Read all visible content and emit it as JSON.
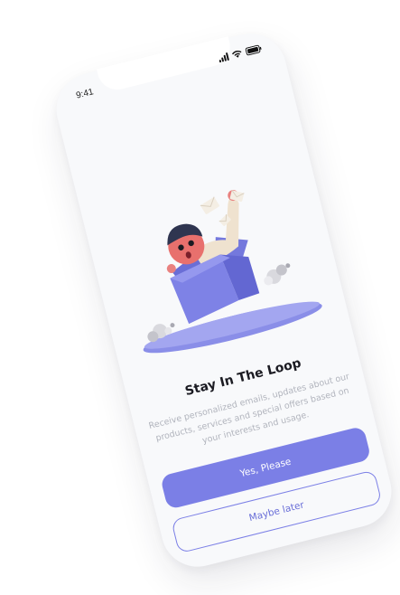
{
  "status_bar": {
    "time": "9:41"
  },
  "onboarding": {
    "illustration": "boy-in-box-with-letters",
    "title": "Stay In The Loop",
    "description": "Receive personalized emails, updates about our products, services and special offers based on your interests and usage."
  },
  "actions": {
    "primary_label": "Yes, Please",
    "secondary_label": "Maybe later"
  },
  "colors": {
    "accent": "#7b7fe6",
    "background": "#f8f9fb",
    "title": "#1b1b22",
    "description": "#b1b4bd"
  }
}
